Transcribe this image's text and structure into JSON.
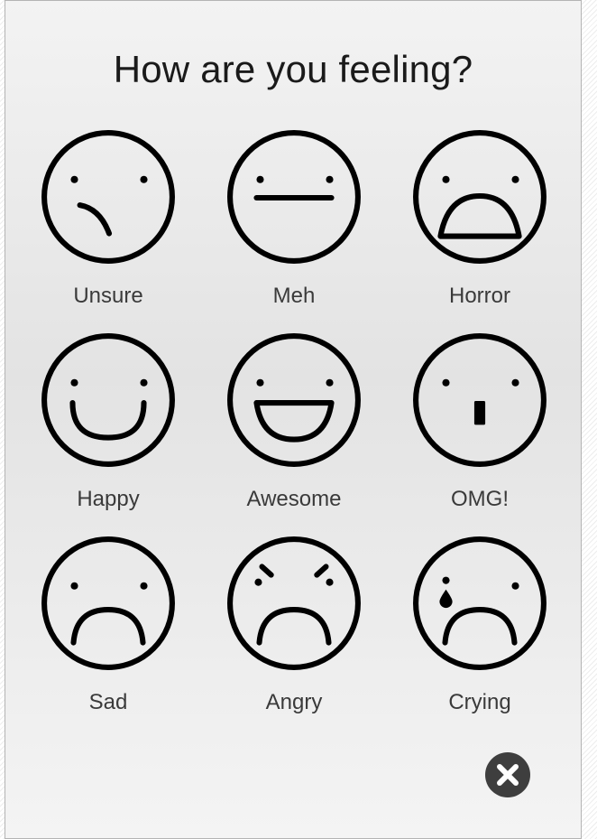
{
  "dialog": {
    "title": "How are you feeling?"
  },
  "moods": [
    {
      "label": "Unsure",
      "icon": "unsure-face-icon"
    },
    {
      "label": "Meh",
      "icon": "meh-face-icon"
    },
    {
      "label": "Horror",
      "icon": "horror-face-icon"
    },
    {
      "label": "Happy",
      "icon": "happy-face-icon"
    },
    {
      "label": "Awesome",
      "icon": "awesome-face-icon"
    },
    {
      "label": "OMG!",
      "icon": "omg-face-icon"
    },
    {
      "label": "Sad",
      "icon": "sad-face-icon"
    },
    {
      "label": "Angry",
      "icon": "angry-face-icon"
    },
    {
      "label": "Crying",
      "icon": "crying-face-icon"
    }
  ],
  "close_button": {
    "icon": "close-icon"
  },
  "colors": {
    "ink": "#000000",
    "label": "#3a3a3a",
    "close_bg": "#3e3e3e"
  }
}
